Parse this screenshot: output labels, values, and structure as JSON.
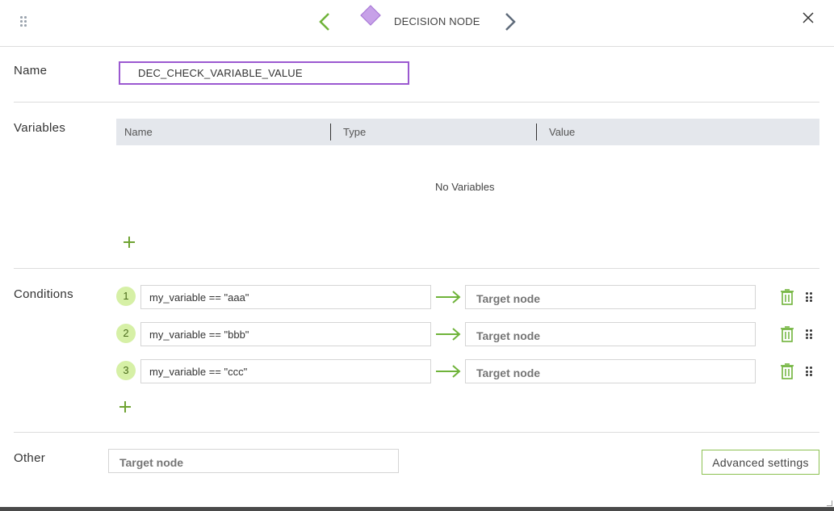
{
  "header": {
    "node_type": "DECISION NODE",
    "icons": {
      "drag": "drag-handle-icon",
      "prev": "chevron-left-icon",
      "next": "chevron-right-icon",
      "node": "diamond-icon",
      "close": "close-icon"
    },
    "colors": {
      "nav_prev": "#6fb33a",
      "nav_next": "#5f6b7a",
      "diamond": "#c7a1e8"
    }
  },
  "name_section": {
    "label": "Name",
    "value": "DEC_CHECK_VARIABLE_VALUE",
    "accent": "#9b59d0"
  },
  "variables_section": {
    "label": "Variables",
    "columns": [
      "Name",
      "Type",
      "Value"
    ],
    "empty_text": "No Variables"
  },
  "conditions_section": {
    "label": "Conditions",
    "rows": [
      {
        "num": "1",
        "expression": "my_variable == \"aaa\"",
        "target_placeholder": "Target node"
      },
      {
        "num": "2",
        "expression": "my_variable == \"bbb\"",
        "target_placeholder": "Target node"
      },
      {
        "num": "3",
        "expression": "my_variable == \"ccc\"",
        "target_placeholder": "Target node"
      }
    ],
    "accent": "#6fb33a"
  },
  "other_section": {
    "label": "Other",
    "target_placeholder": "Target node",
    "advanced_label": "Advanced settings"
  }
}
